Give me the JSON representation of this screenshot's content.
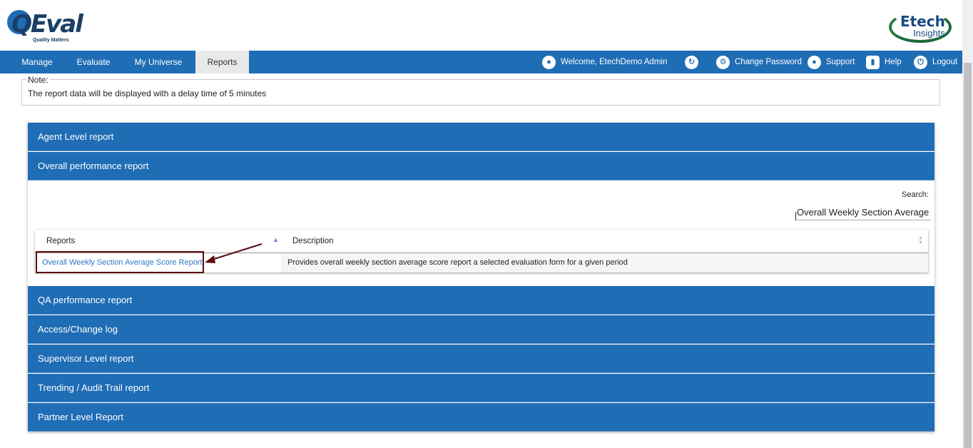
{
  "brand": {
    "qeval_logo": "QEval",
    "qeval_tagline": "Quality Matters",
    "etech_logo": "Etech",
    "etech_sub": "Insights"
  },
  "nav": {
    "items": [
      {
        "label": "Manage"
      },
      {
        "label": "Evaluate"
      },
      {
        "label": "My Universe"
      },
      {
        "label": "Reports"
      }
    ],
    "welcome": "Welcome, EtechDemo Admin",
    "change_password": "Change Password",
    "support": "Support",
    "help": "Help",
    "logout": "Logout"
  },
  "note": {
    "legend": "Note:",
    "text": "The report data will be displayed with a delay time of 5 minutes"
  },
  "accordion": {
    "sections": [
      {
        "label": "Agent Level report"
      },
      {
        "label": "Overall performance report"
      },
      {
        "label": "QA performance report"
      },
      {
        "label": "Access/Change log"
      },
      {
        "label": "Supervisor Level report"
      },
      {
        "label": "Trending / Audit Trail report"
      },
      {
        "label": "Partner Level Report"
      }
    ]
  },
  "search": {
    "label": "Search:",
    "value": "Overall Weekly Section Average"
  },
  "table": {
    "columns": [
      "Reports",
      "Description"
    ],
    "rows": [
      {
        "report": "Overall Weekly Section Average Score Report",
        "description": "Provides overall weekly section average score report a selected evaluation form for a given period"
      }
    ]
  },
  "colors": {
    "primary": "#1f6db5",
    "active_tab": "#e9e9e9",
    "link": "#2a78c8",
    "highlight": "#5a0e12"
  }
}
